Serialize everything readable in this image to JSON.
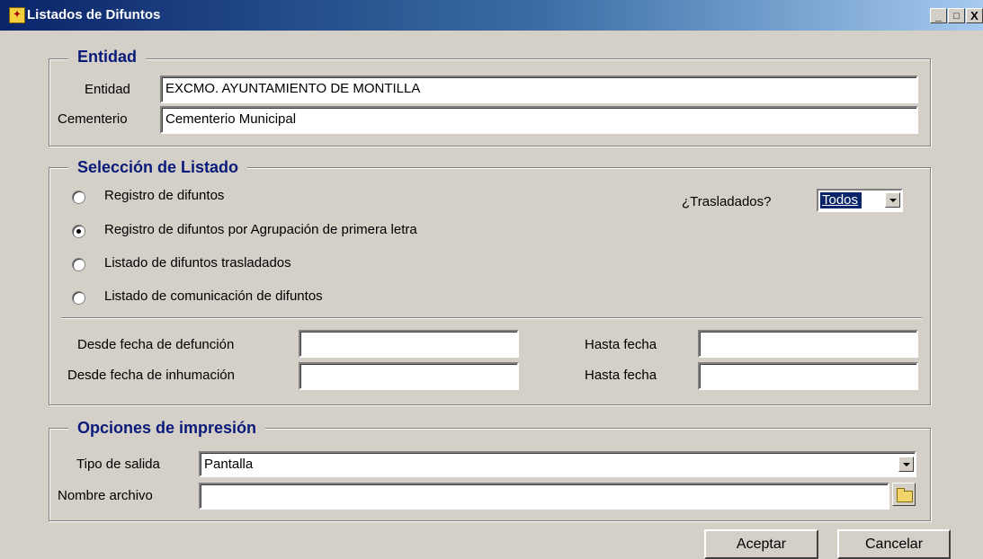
{
  "window": {
    "title": "Listados de Difuntos",
    "minimize": "_",
    "maximize": "□",
    "close": "X"
  },
  "entidad": {
    "legend": "Entidad",
    "entidad_label": "Entidad",
    "entidad_value": "EXCMO. AYUNTAMIENTO DE MONTILLA",
    "cementerio_label": "Cementerio",
    "cementerio_value": "Cementerio Municipal"
  },
  "seleccion": {
    "legend": "Selección de Listado",
    "options": [
      {
        "label": "Registro de difuntos",
        "selected": false
      },
      {
        "label": "Registro de difuntos por Agrupación de primera letra",
        "selected": true
      },
      {
        "label": "Listado de difuntos trasladados",
        "selected": false
      },
      {
        "label": "Listado de comunicación de difuntos",
        "selected": false
      }
    ],
    "trasladados_label": "¿Trasladados?",
    "trasladados_value": "Todos",
    "desde_defuncion_label": "Desde fecha de defunción",
    "desde_defuncion_value": "",
    "hasta_fecha1_label": "Hasta fecha",
    "hasta_fecha1_value": "",
    "desde_inhumacion_label": "Desde fecha de inhumación",
    "desde_inhumacion_value": "",
    "hasta_fecha2_label": "Hasta fecha",
    "hasta_fecha2_value": ""
  },
  "impresion": {
    "legend": "Opciones de impresión",
    "tipo_label": "Tipo de salida",
    "tipo_value": "Pantalla",
    "nombre_label": "Nombre archivo",
    "nombre_value": ""
  },
  "buttons": {
    "aceptar": "Aceptar",
    "cancelar": "Cancelar"
  },
  "icons": {
    "title": "app-icon",
    "browse": "folder-icon"
  },
  "colors": {
    "legend": "#0a1a7a",
    "titlebar": "#0a246a",
    "highlight": "#0a246a"
  }
}
